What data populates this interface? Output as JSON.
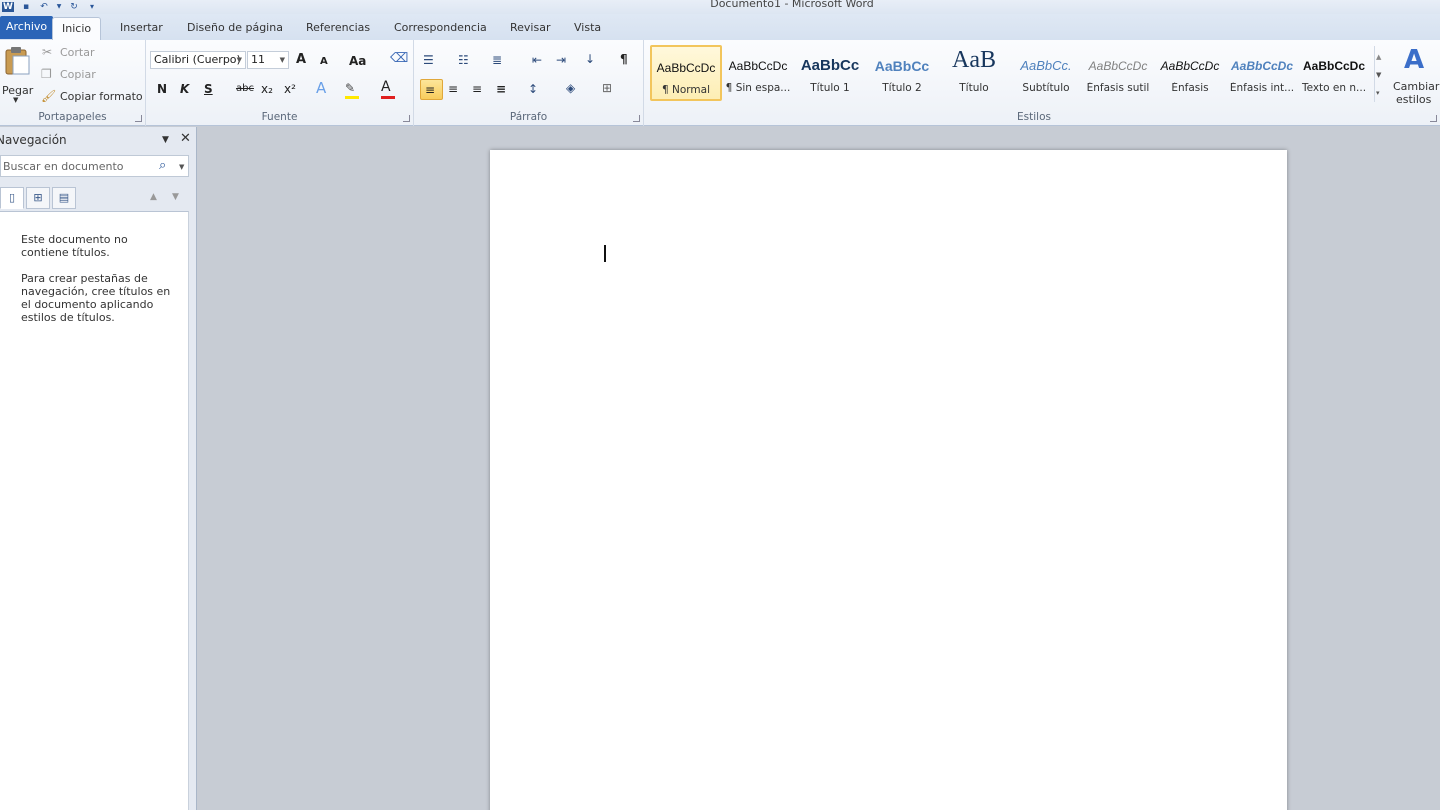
{
  "window": {
    "title": "Documento1 - Microsoft Word"
  },
  "quick_access": [
    "word-logo-icon",
    "save-icon",
    "undo-icon",
    "redo-icon",
    "customize-icon"
  ],
  "tabs": [
    {
      "label": "Archivo"
    },
    {
      "label": "Inicio"
    },
    {
      "label": "Insertar"
    },
    {
      "label": "Diseño de página"
    },
    {
      "label": "Referencias"
    },
    {
      "label": "Correspondencia"
    },
    {
      "label": "Revisar"
    },
    {
      "label": "Vista"
    }
  ],
  "ribbon": {
    "clipboard": {
      "label": "Portapapeles",
      "paste": "Pegar",
      "cut": "Cortar",
      "copy": "Copiar",
      "format_painter": "Copiar formato"
    },
    "font": {
      "label": "Fuente",
      "family": "Calibri (Cuerpo)",
      "size": "11",
      "bold": "N",
      "italic": "K",
      "underline": "S",
      "strike": "abc",
      "subscript": "x₂",
      "superscript": "x²",
      "grow": "A",
      "shrink": "A",
      "case": "Aa",
      "font_color": "#e02020",
      "highlight_color": "#ffe800"
    },
    "paragraph": {
      "label": "Párrafo",
      "show_marks": "¶"
    },
    "styles": {
      "label": "Estilos",
      "items": [
        {
          "preview": "AaBbCcDc",
          "name": "¶ Normal"
        },
        {
          "preview": "AaBbCcDc",
          "name": "¶ Sin espa..."
        },
        {
          "preview": "AaBbCc",
          "name": "Título 1"
        },
        {
          "preview": "AaBbCc",
          "name": "Título 2"
        },
        {
          "preview": "AaB",
          "name": "Título"
        },
        {
          "preview": "AaBbCc.",
          "name": "Subtítulo"
        },
        {
          "preview": "AaBbCcDc",
          "name": "Énfasis sutil"
        },
        {
          "preview": "AaBbCcDc",
          "name": "Énfasis"
        },
        {
          "preview": "AaBbCcDc",
          "name": "Énfasis int..."
        },
        {
          "preview": "AaBbCcDc",
          "name": "Texto en n..."
        }
      ],
      "change_styles_line1": "Cambiar",
      "change_styles_line2": "estilos"
    }
  },
  "navigation": {
    "title": "Navegación",
    "search_placeholder": "Buscar en documento",
    "message_line1": "Este documento no contiene títulos.",
    "message_line2": "Para crear pestañas de navegación, cree títulos en el documento aplicando estilos de títulos."
  }
}
